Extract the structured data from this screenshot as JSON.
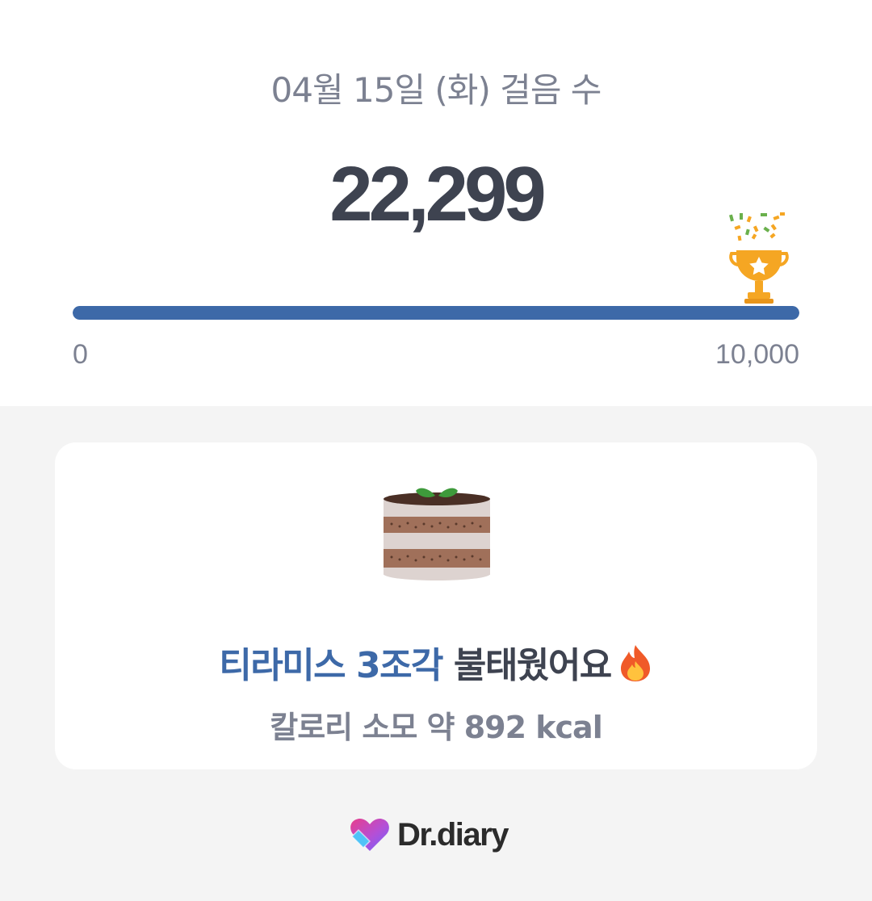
{
  "header": {
    "title": "04월 15일 (화) 걸음 수",
    "step_count": "22,299"
  },
  "progress": {
    "min_label": "0",
    "max_label": "10,000",
    "steps": 22299,
    "goal": 10000,
    "fill_fraction": 1.0,
    "goal_icon": "trophy-icon"
  },
  "result_card": {
    "icon": "tiramisu-cake-icon",
    "headline_highlight": "티라미스 3조각",
    "headline_rest": "불태웠어요",
    "headline_icon": "fire-icon",
    "subline": "칼로리 소모 약 892 kcal"
  },
  "footer": {
    "logo_icon": "heart-logo-icon",
    "brand": "Dr.diary"
  },
  "colors": {
    "accent": "#3d69a8",
    "text_dark": "#3e4350",
    "text_muted": "#7c8191",
    "background": "#f4f4f4",
    "trophy": "#f5a623"
  }
}
